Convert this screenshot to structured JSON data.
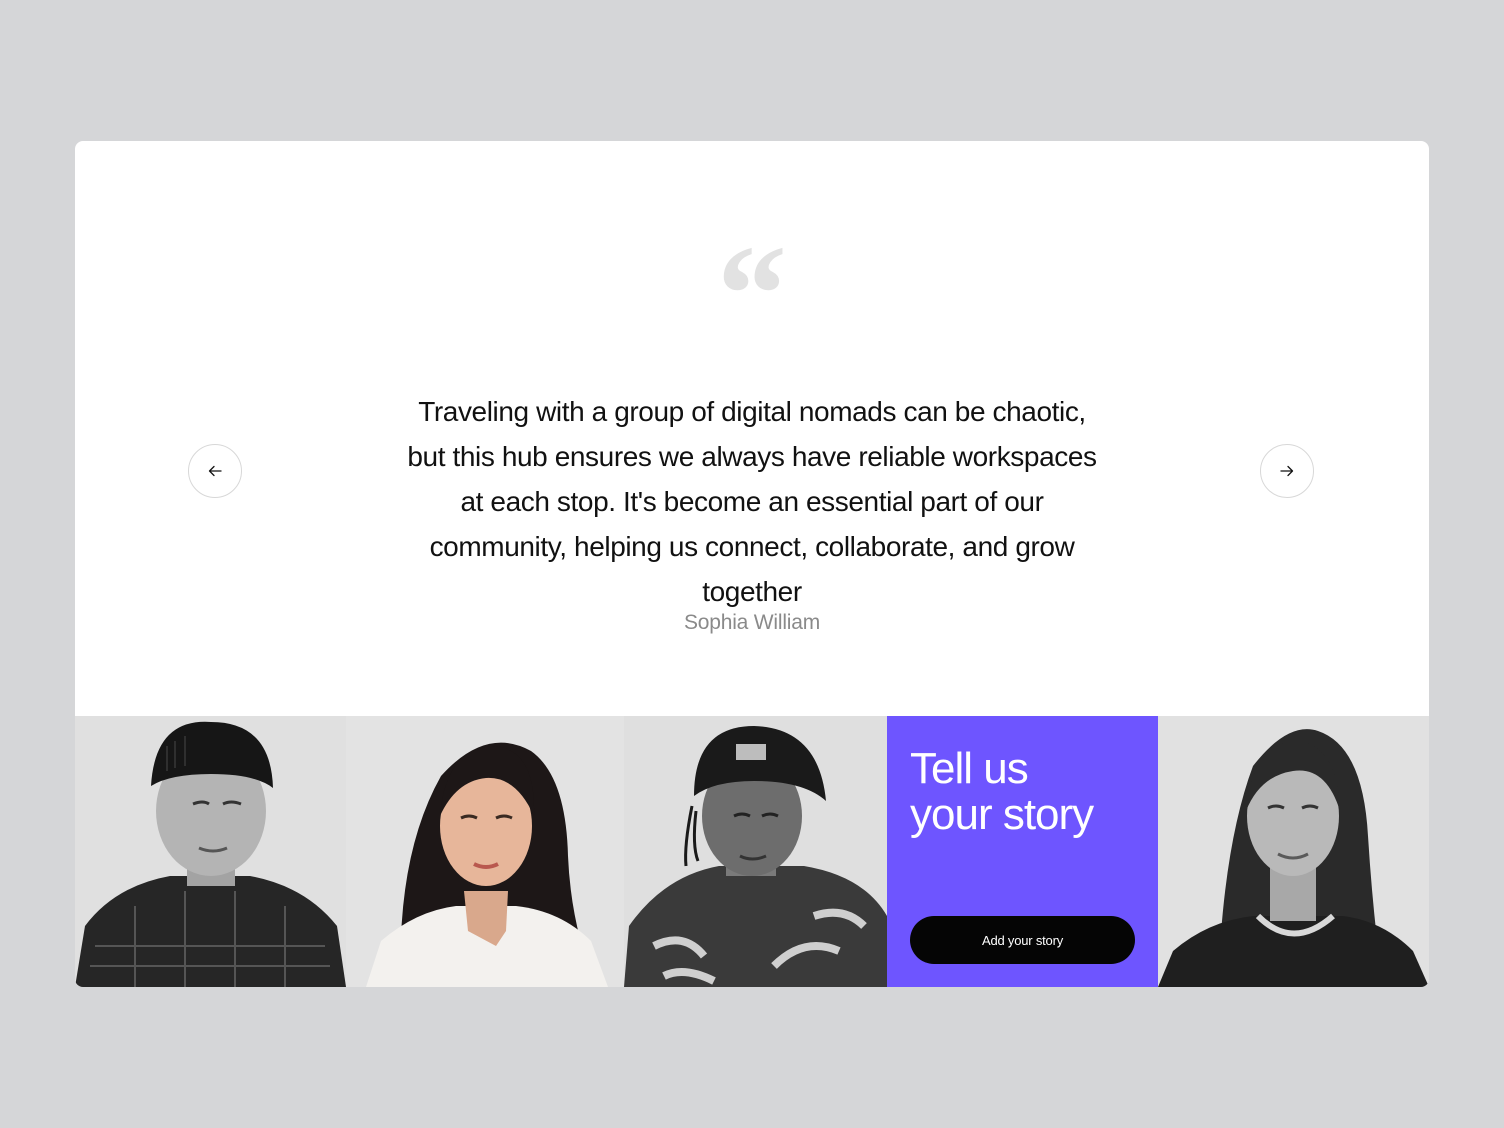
{
  "testimonial": {
    "quote_icon": "quote-mark-icon",
    "text": "Traveling with a group of digital nomads can be chaotic, but this hub ensures we always have reliable workspaces at each stop. It's become an essential part of our community, helping us connect, collaborate, and grow together",
    "author": "Sophia William"
  },
  "navigation": {
    "prev_icon": "arrow-left-icon",
    "next_icon": "arrow-right-icon"
  },
  "cta": {
    "title_line1": "Tell us",
    "title_line2": "your story",
    "button_label": "Add your story"
  },
  "colors": {
    "background": "#d5d6d8",
    "card": "#ffffff",
    "accent": "#6e55ff",
    "button": "#050505",
    "author_text": "#8a8a8a"
  }
}
